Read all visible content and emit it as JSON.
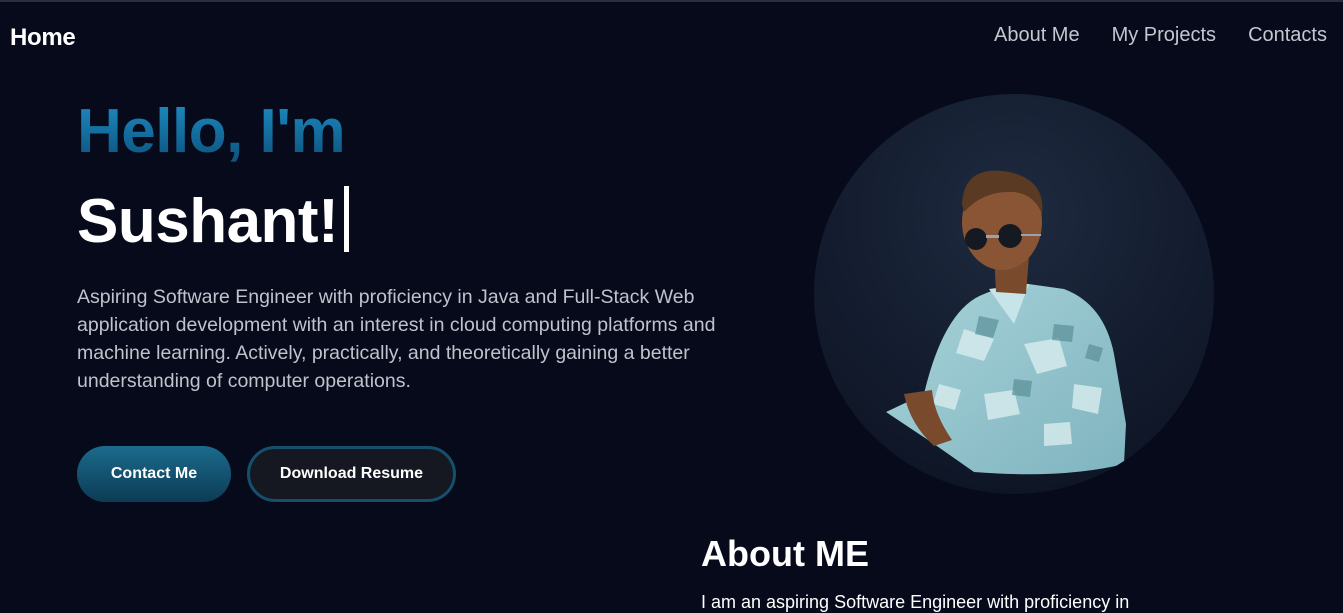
{
  "nav": {
    "brand": "Home",
    "links": [
      "About Me",
      "My Projects",
      "Contacts"
    ]
  },
  "hero": {
    "greeting": "Hello, I'm",
    "name": "Sushant!",
    "description": "Aspiring Software Engineer with proficiency in Java and Full-Stack Web application development with an interest in cloud computing platforms and machine learning. Actively, practically, and theoretically gaining a better understanding of computer operations.",
    "contact_button": "Contact Me",
    "resume_button": "Download Resume"
  },
  "about": {
    "title": "About ME",
    "text": "I am an aspiring Software Engineer with proficiency in"
  },
  "colors": {
    "background": "#060a1a",
    "accent": "#1f8fc7",
    "button_gradient_top": "#1b6b8d"
  }
}
